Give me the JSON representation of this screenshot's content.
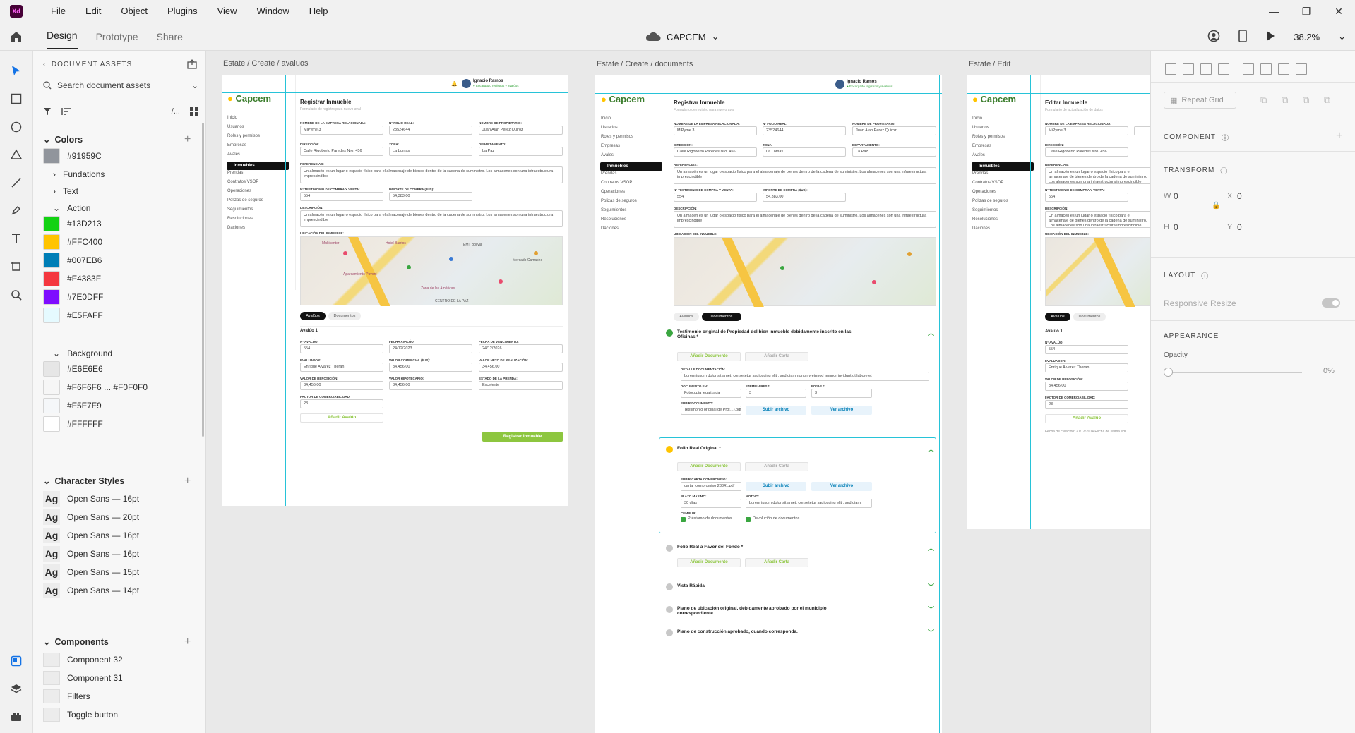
{
  "app": {
    "logo_text": "Xd",
    "title": "CAPCEM",
    "zoom": "38.2%"
  },
  "menu": [
    "File",
    "Edit",
    "Object",
    "Plugins",
    "View",
    "Window",
    "Help"
  ],
  "tabs": {
    "design": "Design",
    "prototype": "Prototype",
    "share": "Share"
  },
  "assets": {
    "header": "DOCUMENT ASSETS",
    "search_placeholder": "Search document assets",
    "colors_title": "Colors",
    "color_first": "#91959C",
    "folders": [
      "Fundations",
      "Text",
      "Action"
    ],
    "action_colors": [
      {
        "label": "#13D213",
        "hex": "#13D213"
      },
      {
        "label": "#FFC400",
        "hex": "#FFC400"
      },
      {
        "label": "#007EB6",
        "hex": "#007EB6"
      },
      {
        "label": "#F4383F",
        "hex": "#F4383F"
      },
      {
        "label": "#7E0DFF",
        "hex": "#7E0DFF"
      },
      {
        "label": "#E5FAFF",
        "hex": "#E5FAFF"
      }
    ],
    "background_title": "Background",
    "background_colors": [
      {
        "label": "#E6E6E6",
        "hex": "#E6E6E6"
      },
      {
        "label": "#F6F6F6 ... #F0F0F0",
        "hex": "#F6F6F6"
      },
      {
        "label": "#F5F7F9",
        "hex": "#F5F7F9"
      },
      {
        "label": "#FFFFFF",
        "hex": "#FFFFFF"
      }
    ],
    "char_styles_title": "Character Styles",
    "char_styles": [
      {
        "ag": "Ag",
        "label": "Open Sans — 16pt"
      },
      {
        "ag": "Ag",
        "label": "Open Sans — 20pt"
      },
      {
        "ag": "Ag",
        "label": "Open Sans — 16pt"
      },
      {
        "ag": "Ag",
        "label": "Open Sans — 16pt"
      },
      {
        "ag": "Ag",
        "label": "Open Sans — 15pt"
      },
      {
        "ag": "Ag",
        "label": "Open Sans — 14pt"
      }
    ],
    "components_title": "Components",
    "components": [
      "Component 32",
      "Component 31",
      "Filters",
      "Toggle button"
    ]
  },
  "artboards": {
    "labels": [
      "Estate / Create / avaluos",
      "Estate / Create / documents",
      "Estate / Edit"
    ],
    "logo": "Capcem",
    "user_name": "Ignacio Ramos",
    "user_status": "● Encargado registros y avalúos",
    "nav": [
      "Inicio",
      "Usuarios",
      "Roles y permisos",
      "Empresas",
      "Avales",
      "Inmuebles",
      "Prendas",
      "Contratos VSOP",
      "Operaciones",
      "Polizas de seguros",
      "Seguimientos",
      "Resoluciones",
      "Daciones"
    ],
    "title_create": "Registrar Inmueble",
    "title_edit": "Editar Inmueble",
    "subtitle_create": "Formulario de registro para nuevo aval",
    "subtitle_edit": "Formulario de actualización de datos",
    "fields": {
      "empresa_label": "Nombre de la empresa relacionada:",
      "empresa_value": "MiPyme 3",
      "folio_label": "N° Folio real:",
      "folio_value": "23524644",
      "propietario_label": "Nombre de propietario:",
      "propietario_value": "Juan Alan Perez Quiroz",
      "direccion_label": "Dirección:",
      "direccion_value": "Calle Rigoberto Paredes Nro. 456",
      "zona_label": "Zona:",
      "zona_value": "La Lomas",
      "depto_label": "Departamento:",
      "depto_value": "La Paz",
      "referencias_label": "Referencias:",
      "referencias_value": "Un almacén es un lugar o espacio físico para el almacenaje de bienes dentro de la cadena de suministro. Los almacenes son una infraestructura imprescindible",
      "testimonio_label": "N° Testimonio de compra y venta:",
      "testimonio_value": "554",
      "importe_label": "Importe de compra ($us):",
      "importe_value": "54,383.00",
      "descripcion_label": "Descripción:",
      "ubicacion_label": "Ubicación del inmueble:"
    },
    "map_labels": [
      "Multicenter",
      "Hotel Barrios",
      "EMT Bolivia",
      "Mercado Camacho",
      "Aparcamiento Pavoni",
      "Zona de las Américas",
      "CENTRO DE LA PAZ"
    ],
    "tab_avaluos": "Avalúos",
    "tab_documentos": "Documentos",
    "avaluo": {
      "title": "Avalúo 1",
      "n_label": "N° Avalúo:",
      "n_value": "554",
      "fecha_label": "Fecha avalúo:",
      "fecha_value": "24/12/2023",
      "venc_label": "Fecha de vencimiento:",
      "venc_value": "24/12/2026",
      "evaluador_label": "Evaluador:",
      "evaluador_value": "Enrique Alvarez Theran",
      "comercial_label": "Valor comercial ($us):",
      "comercial_value": "34,456.00",
      "neto_label": "Valor neto de realización:",
      "neto_value": "34,456.00",
      "reposicion_label": "Valor de reposición:",
      "reposicion_value": "34,456.00",
      "hipotecario_label": "Valor hipotecario:",
      "hipotecario_value": "34,456.00",
      "estado_label": "Estado de la prenda:",
      "estado_value": "Excelente",
      "factor_label": "Factor de comerciabilidad:",
      "factor_value": "23",
      "add_label": "Añadir Avalúo",
      "submit_label": "Registrar Inmueble"
    },
    "documents": [
      {
        "title": "Testimonio original de Propiedad del bien inmueble debidamente inscrito en las Oficinas *",
        "state": "done"
      },
      {
        "title": "Folio Real Original *",
        "state": "warn"
      },
      {
        "title": "Folio Real a Favor del Fondo *",
        "state": "pending"
      },
      {
        "title": "Vista Rápida",
        "state": "pending"
      },
      {
        "title": "Plano de ubicación original, debidamente aprobado por el municipio correspondiente.",
        "state": "pending"
      },
      {
        "title": "Plano de construcción aprobado, cuando corresponda.",
        "state": "pending"
      }
    ],
    "doc_buttons": {
      "add_doc": "Añadir Documento",
      "add_card": "Añadir Carta",
      "upload": "Subir archivo",
      "view": "Ver archivo",
      "detalle_label": "Detalle documentación:",
      "detalle_value": "Lorem ipsum dolor sit amet, consetetur sadipscing elitr, sed diam nonumy eirmod tempor invidunt ut labore et",
      "doc_en_label": "Documento en:",
      "doc_en_value": "Fotocopia legalizada",
      "ejemplares_label": "Ejemplares *:",
      "ejemplares_value": "3",
      "fojas_label": "Fojas *:",
      "fojas_value": "3",
      "subir_label": "Subir documento:",
      "subir_value": "Testimonio original de Pro(...).pdf",
      "carta_label": "Subir carta compromiso:",
      "carta_value": "carta_compromiso 23341.pdf",
      "plazo_label": "Plazo máximo:",
      "plazo_value": "30 días",
      "motivo_label": "Motivo:",
      "motivo_value": "Lorem ipsum dolor sit amet, consetetur sadipscing elitr, sed diam.",
      "cumplir_label": "Cumplir:",
      "check1": "Préstamo de documentos",
      "check2": "Devolución de documentos"
    },
    "edit_footer": "Fecha de creación: 21/12/2004   Fecha de última edi"
  },
  "props": {
    "repeat_grid": "Repeat Grid",
    "component": "COMPONENT",
    "transform": "TRANSFORM",
    "w_label": "W",
    "w_value": "0",
    "x_label": "X",
    "x_value": "0",
    "h_label": "H",
    "h_value": "0",
    "y_label": "Y",
    "y_value": "0",
    "layout": "LAYOUT",
    "responsive": "Responsive Resize",
    "appearance": "APPEARANCE",
    "opacity_label": "Opacity",
    "opacity_value": "0%"
  }
}
